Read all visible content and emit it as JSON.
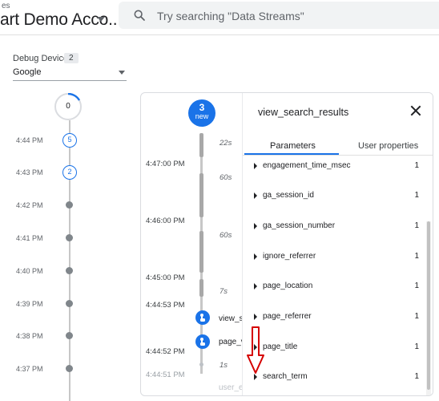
{
  "header": {
    "breadcrumb": "es",
    "account_name": "art Demo Acco...",
    "search_placeholder": "Try searching \"Data Streams\""
  },
  "debug": {
    "label": "Debug Device",
    "count": "2",
    "device": "Google"
  },
  "minutes": {
    "top_count": "0",
    "rows": [
      {
        "time": "4:44 PM",
        "count": "5"
      },
      {
        "time": "4:43 PM",
        "count": "2"
      },
      {
        "time": "4:42 PM",
        "count": ""
      },
      {
        "time": "4:41 PM",
        "count": ""
      },
      {
        "time": "4:40 PM",
        "count": ""
      },
      {
        "time": "4:39 PM",
        "count": ""
      },
      {
        "time": "4:38 PM",
        "count": ""
      },
      {
        "time": "4:37 PM",
        "count": ""
      }
    ]
  },
  "seconds": {
    "new_count": "3",
    "new_label": "new",
    "times": [
      "4:47:00 PM",
      "4:46:00 PM",
      "4:45:00 PM",
      "4:44:53 PM",
      "4:44:52 PM",
      "4:44:51 PM"
    ],
    "gaps": [
      "22s",
      "60s",
      "60s",
      "7s",
      "1s"
    ],
    "events": [
      "view_search_results",
      "page_view",
      "user_engagement"
    ]
  },
  "detail": {
    "event_name": "view_search_results",
    "tabs": [
      "Parameters",
      "User properties"
    ],
    "params": [
      {
        "key": "engagement_time_msec",
        "value": "1"
      },
      {
        "key": "ga_session_id",
        "value": "1"
      },
      {
        "key": "ga_session_number",
        "value": "1"
      },
      {
        "key": "ignore_referrer",
        "value": "1"
      },
      {
        "key": "page_location",
        "value": "1"
      },
      {
        "key": "page_referrer",
        "value": "1"
      },
      {
        "key": "page_title",
        "value": "1"
      },
      {
        "key": "search_term",
        "value": "1"
      }
    ]
  },
  "colors": {
    "accent": "#1a73e8",
    "annotation": "#d50000"
  }
}
